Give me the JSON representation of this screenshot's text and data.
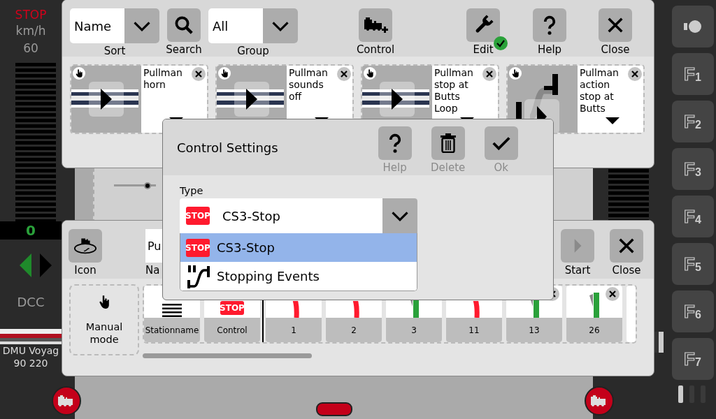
{
  "loco_left": {
    "status": "STOP",
    "unit": "km/h",
    "max_speed": "60",
    "speed": "0",
    "direction_arrows": [
      {
        "selected": true
      },
      {
        "selected": false
      }
    ],
    "protocol": "DCC",
    "name": "DMU Voyag",
    "number": "90 220"
  },
  "functions": [
    {
      "kind": "light"
    },
    {
      "kind": "function",
      "letter": "F",
      "number": "1"
    },
    {
      "kind": "function",
      "letter": "F",
      "number": "2"
    },
    {
      "kind": "function",
      "letter": "F",
      "number": "3"
    },
    {
      "kind": "function",
      "letter": "F",
      "number": "4"
    },
    {
      "kind": "function",
      "letter": "F",
      "number": "5"
    },
    {
      "kind": "function",
      "letter": "F",
      "number": "6"
    },
    {
      "kind": "function",
      "letter": "F",
      "number": "7"
    }
  ],
  "pages": [
    {
      "selected": true
    },
    {
      "selected": false
    },
    {
      "selected": false
    }
  ],
  "top_panel": {
    "sort": {
      "value": "Name",
      "label": "Sort"
    },
    "search": {
      "label": "Search"
    },
    "group": {
      "value": "All",
      "label": "Group"
    },
    "buttons": [
      {
        "kind": "control",
        "label": "Control"
      },
      {
        "kind": "edit",
        "label": "Edit",
        "checked": true
      },
      {
        "kind": "help",
        "label": "Help"
      },
      {
        "kind": "close",
        "label": "Close"
      }
    ],
    "cards": [
      {
        "kind": "photo",
        "title": "Pullman horn"
      },
      {
        "kind": "photo",
        "title": "Pullman sounds off"
      },
      {
        "kind": "photo",
        "title": "Pullman stop at Butts Loop"
      },
      {
        "kind": "track",
        "title": "Pullman action stop at Butts"
      }
    ]
  },
  "bottom_panel": {
    "icon_label": "Icon",
    "name_value": "Pu",
    "name_label": "Na",
    "start": {
      "label": "Start",
      "disabled": true
    },
    "close": {
      "label": "Close"
    },
    "manual": "Manual mode",
    "columns": [
      {
        "kind": "stationname",
        "label": "Stationname"
      },
      {
        "kind": "control",
        "label": "Control",
        "icon_text": "STOP"
      },
      {
        "kind": "turnout",
        "label": "1",
        "diverging": true
      },
      {
        "kind": "turnout",
        "label": "2",
        "diverging": true
      },
      {
        "kind": "turnout",
        "label": "3",
        "diverging": false
      },
      {
        "kind": "turnout",
        "label": "11",
        "diverging": true
      },
      {
        "kind": "turnout",
        "label": "13",
        "diverging": false,
        "removable": true
      },
      {
        "kind": "turnout",
        "label": "26",
        "diverging": false,
        "removable": true
      }
    ]
  },
  "dialog": {
    "title": "Control Settings",
    "buttons": [
      {
        "kind": "help",
        "label": "Help"
      },
      {
        "kind": "delete",
        "label": "Delete"
      },
      {
        "kind": "ok",
        "label": "Ok"
      }
    ],
    "type_label": "Type",
    "type": {
      "icon_text": "STOP",
      "value": "CS3-Stop"
    },
    "options": [
      {
        "kind": "stop",
        "icon_text": "STOP",
        "label": "CS3-Stop",
        "selected": true
      },
      {
        "kind": "events",
        "label": "Stopping Events",
        "selected": false
      }
    ]
  }
}
